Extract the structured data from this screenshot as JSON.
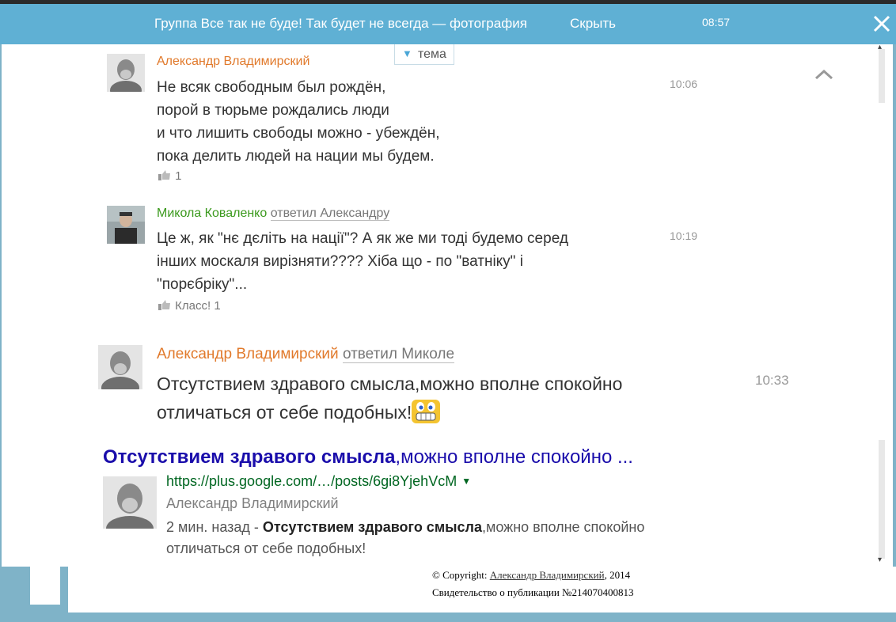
{
  "topbar": {
    "title": "Группа Все так не буде! Так будет не всегда — фотография",
    "hide": "Скрыть",
    "time": "08:57"
  },
  "topic_tab": "тема",
  "comments": [
    {
      "author": "Александр Владимирский",
      "reply_to": "",
      "lines": [
        "Не всяк свободным был рождён,",
        "порой в тюрьме рождались люди",
        "и что лишить свободы можно - убеждён,",
        "пока делить людей на нации мы будем."
      ],
      "time": "10:06",
      "likes": "1"
    },
    {
      "author": "Микола Коваленко",
      "reply_to": "ответил Александру",
      "lines": [
        "Це ж, як \"нє дєліть на нації\"? А як же ми тоді будемо серед",
        "інших москаля вирізняти???? Хіба що - по \"ватніку\" і",
        "\"порєбріку\"..."
      ],
      "time": "10:19",
      "likes": "Класс! 1"
    },
    {
      "author": "Александр Владимирский",
      "reply_to": "ответил Миколе",
      "lines": [
        "Отсутствием здравого смысла,можно вполне спокойно",
        "отличаться от себе подобных!"
      ],
      "time": "10:33"
    }
  ],
  "search_result": {
    "title_bold": "Отсутствием здравого смысла",
    "title_rest": ",можно вполне спокойно ...",
    "url": "https://plus.google.com/…/posts/6gi8YjehVcM",
    "name": "Александр Владимирский",
    "snippet_prefix": "2 мин. назад - ",
    "snippet_bold": "Отсутствием здравого смысла",
    "snippet_rest": ",можно вполне спокойно отличаться от себе подобных!"
  },
  "footer": {
    "copyright_prefix": "© Copyright: ",
    "copyright_author": "Александр Владимирский",
    "copyright_year": ", 2014",
    "certificate": "Свидетельство о публикации №214070400813"
  },
  "colors": {
    "topbar": "#5fb0d4",
    "author_orange": "#e17a2c",
    "author_green": "#3c9a1e",
    "link_blue": "#1a0dab",
    "url_green": "#006621"
  }
}
